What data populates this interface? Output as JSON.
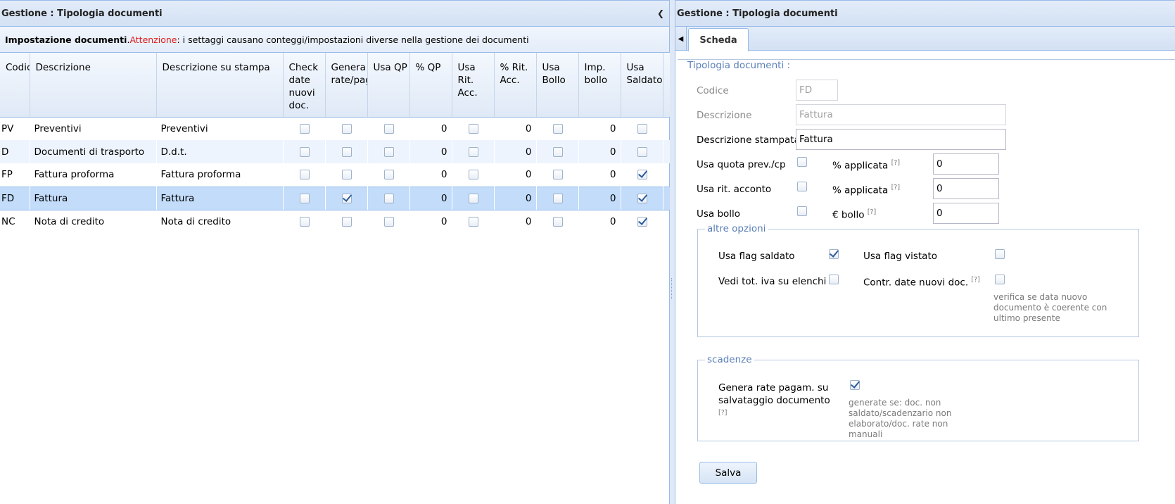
{
  "left": {
    "title": "Gestione : Tipologia documenti",
    "notice_bold": "Impostazione documenti",
    "notice_dot": ". ",
    "notice_warn": "Attenzione",
    "notice_rest": ": i settaggi causano conteggi/impostazioni diverse nella gestione dei documenti",
    "columns": [
      "Codic",
      "Descrizione",
      "Descrizione su stampa",
      "Check date nuovi doc.",
      "Genera rate/pag",
      "Usa QP",
      "% QP",
      "Usa Rit. Acc.",
      "% Rit. Acc.",
      "Usa Bollo",
      "Imp. bollo",
      "Usa Saldato"
    ],
    "rows": [
      {
        "code": "PV",
        "desc": "Preventivi",
        "print": "Preventivi",
        "check": false,
        "genera": false,
        "qp": false,
        "pqp": "0",
        "rit": false,
        "prit": "0",
        "bollo": false,
        "imp": "0",
        "saldato": false
      },
      {
        "code": "D",
        "desc": "Documenti di trasporto",
        "print": "D.d.t.",
        "check": false,
        "genera": false,
        "qp": false,
        "pqp": "0",
        "rit": false,
        "prit": "0",
        "bollo": false,
        "imp": "0",
        "saldato": false
      },
      {
        "code": "FP",
        "desc": "Fattura proforma",
        "print": "Fattura proforma",
        "check": false,
        "genera": false,
        "qp": false,
        "pqp": "0",
        "rit": false,
        "prit": "0",
        "bollo": false,
        "imp": "0",
        "saldato": true
      },
      {
        "code": "FD",
        "desc": "Fattura",
        "print": "Fattura",
        "check": false,
        "genera": true,
        "qp": false,
        "pqp": "0",
        "rit": false,
        "prit": "0",
        "bollo": false,
        "imp": "0",
        "saldato": true
      },
      {
        "code": "NC",
        "desc": "Nota di credito",
        "print": "Nota di credito",
        "check": false,
        "genera": false,
        "qp": false,
        "pqp": "0",
        "rit": false,
        "prit": "0",
        "bollo": false,
        "imp": "0",
        "saldato": true
      }
    ],
    "selected_row": 3
  },
  "right": {
    "title": "Gestione : Tipologia documenti",
    "tab": "Scheda",
    "legend": "Tipologia documenti :",
    "codice_label": "Codice",
    "codice_value": "FD",
    "descrizione_label": "Descrizione",
    "descrizione_value": "Fattura",
    "stampa_label": "Descrizione stampata",
    "stampa_value": "Fattura",
    "quota_label": "Usa quota prev./cp",
    "quota_checked": false,
    "perc_label": "% applicata",
    "perc_value": "0",
    "rit_label": "Usa rit. acconto",
    "rit_checked": false,
    "perc2_label": "% applicata",
    "perc2_value": "0",
    "bollo_label": "Usa bollo",
    "bollo_checked": false,
    "ebollo_label": "€ bollo",
    "ebollo_value": "0",
    "help": "[?]",
    "altre_legend": "altre opzioni",
    "saldato_label": "Usa flag saldato",
    "saldato_checked": true,
    "vistato_label": "Usa flag vistato",
    "vistato_checked": false,
    "iva_label": "Vedi tot. iva su elenchi",
    "iva_checked": false,
    "contr_label": "Contr. date nuovi doc.",
    "contr_checked": false,
    "contr_note": "verifica se data nuovo documento è coerente con ultimo presente",
    "scadenze_legend": "scadenze",
    "genera_label": "Genera rate pagam. su salvataggio documento",
    "genera_checked": true,
    "genera_note": "generate se: doc. non saldato/scadenzario non elaborato/doc. rate non manuali",
    "save_label": "Salva"
  },
  "colors": {
    "header_border": "#99bbe8",
    "selected_row": "#c2dcfa",
    "legend": "#5a7fb8",
    "warning": "#e01b1b"
  }
}
